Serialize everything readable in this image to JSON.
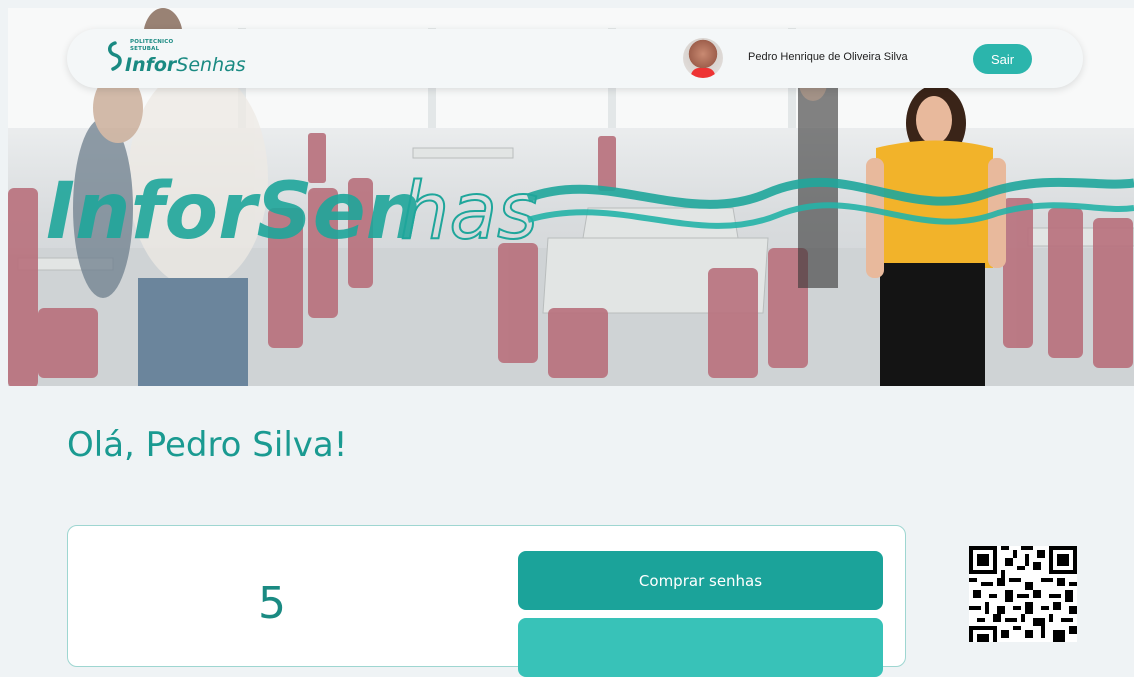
{
  "header": {
    "logo_small_line1": "POLITECNICO",
    "logo_small_line2": "SETUBAL",
    "logo_bold": "Infor",
    "logo_regular": "Senhas",
    "user_name": "Pedro Henrique de Oliveira Silva",
    "logout_label": "Sair"
  },
  "hero": {
    "brand_bold": "InforSen",
    "brand_outline": "has"
  },
  "main": {
    "greeting": "Olá, Pedro Silva!",
    "ticket_count": "5",
    "buy_button_label": "Comprar senhas"
  },
  "colors": {
    "accent": "#1ba39a",
    "accent_light": "#2bb5ac",
    "background": "#eff3f5"
  },
  "icons": {
    "qr": "qr-code-icon",
    "avatar": "user-avatar"
  }
}
